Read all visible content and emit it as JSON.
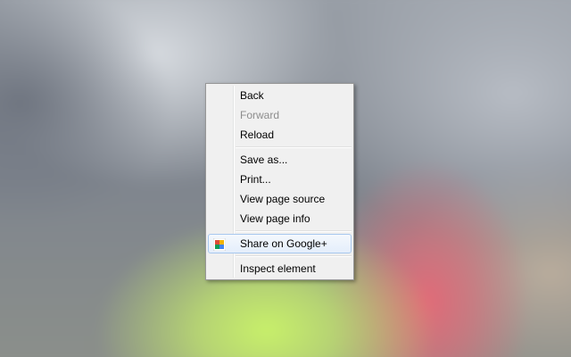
{
  "context_menu": {
    "items": [
      {
        "label": "Back",
        "enabled": true
      },
      {
        "label": "Forward",
        "enabled": false
      },
      {
        "label": "Reload",
        "enabled": true
      },
      {
        "label": "Save as...",
        "enabled": true
      },
      {
        "label": "Print...",
        "enabled": true
      },
      {
        "label": "View page source",
        "enabled": true
      },
      {
        "label": "View page info",
        "enabled": true
      },
      {
        "label": "Share on Google+",
        "enabled": true,
        "highlighted": true,
        "icon": "google-plus-share-icon"
      },
      {
        "label": "Inspect element",
        "enabled": true
      }
    ]
  },
  "colors": {
    "menu_background": "#f0f0f0",
    "menu_border": "#979797",
    "highlight_border": "#a8c8ee",
    "disabled_text": "#8d8d8d"
  }
}
